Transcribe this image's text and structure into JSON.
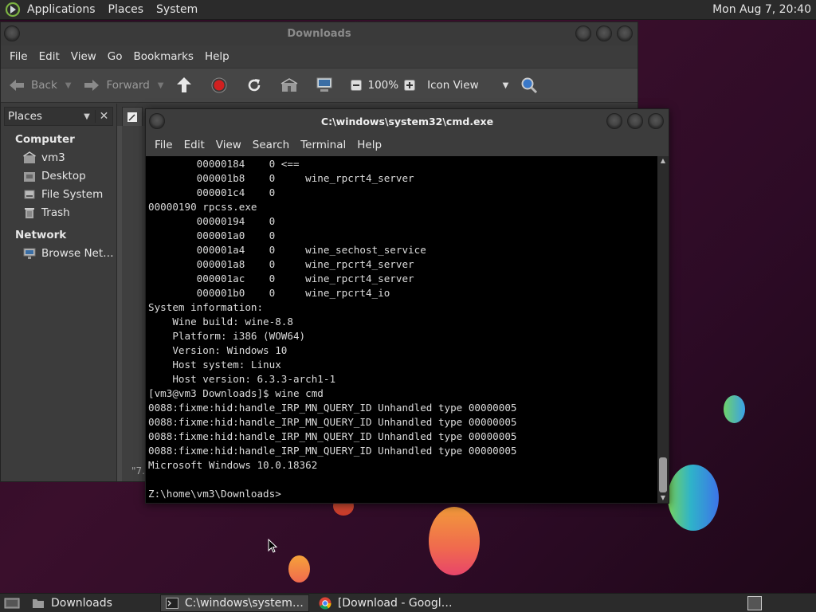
{
  "top_panel": {
    "menu": [
      "Applications",
      "Places",
      "System"
    ],
    "clock": "Mon Aug  7, 20:40"
  },
  "file_manager": {
    "title": "Downloads",
    "menu": [
      "File",
      "Edit",
      "View",
      "Go",
      "Bookmarks",
      "Help"
    ],
    "toolbar": {
      "back_label": "Back",
      "forward_label": "Forward",
      "zoom": "100%",
      "view_mode": "Icon View"
    },
    "sidebar": {
      "header": "Places",
      "groups": [
        {
          "label": "Computer",
          "items": [
            {
              "label": "vm3",
              "icon": "home-folder-icon"
            },
            {
              "label": "Desktop",
              "icon": "desktop-folder-icon"
            },
            {
              "label": "File System",
              "icon": "filesystem-icon"
            },
            {
              "label": "Trash",
              "icon": "trash-icon"
            }
          ]
        },
        {
          "label": "Network",
          "items": [
            {
              "label": "Browse Net…",
              "icon": "network-icon"
            }
          ]
        }
      ]
    },
    "status_fragment": "\"7."
  },
  "terminal": {
    "title": "C:\\windows\\system32\\cmd.exe",
    "menu": [
      "File",
      "Edit",
      "View",
      "Search",
      "Terminal",
      "Help"
    ],
    "lines": [
      "        00000184    0 <==",
      "        000001b8    0     wine_rpcrt4_server",
      "        000001c4    0",
      "00000190 rpcss.exe",
      "        00000194    0",
      "        000001a0    0",
      "        000001a4    0     wine_sechost_service",
      "        000001a8    0     wine_rpcrt4_server",
      "        000001ac    0     wine_rpcrt4_server",
      "        000001b0    0     wine_rpcrt4_io",
      "System information:",
      "    Wine build: wine-8.8",
      "    Platform: i386 (WOW64)",
      "    Version: Windows 10",
      "    Host system: Linux",
      "    Host version: 6.3.3-arch1-1",
      "[vm3@vm3 Downloads]$ wine cmd",
      "0088:fixme:hid:handle_IRP_MN_QUERY_ID Unhandled type 00000005",
      "0088:fixme:hid:handle_IRP_MN_QUERY_ID Unhandled type 00000005",
      "0088:fixme:hid:handle_IRP_MN_QUERY_ID Unhandled type 00000005",
      "0088:fixme:hid:handle_IRP_MN_QUERY_ID Unhandled type 00000005",
      "Microsoft Windows 10.0.18362",
      "",
      "Z:\\home\\vm3\\Downloads>"
    ]
  },
  "taskbar": {
    "items": [
      {
        "label": "Downloads",
        "icon": "folder-icon",
        "active": false
      },
      {
        "label": "C:\\windows\\system…",
        "icon": "terminal-icon",
        "active": true
      },
      {
        "label": "[Download - Googl…",
        "icon": "chrome-icon",
        "active": false
      }
    ]
  },
  "colors": {
    "terminal_bg": "#000000",
    "panel_bg": "#2b2b2b",
    "window_bg": "#3c3c3c",
    "stop_red": "#d02020"
  }
}
